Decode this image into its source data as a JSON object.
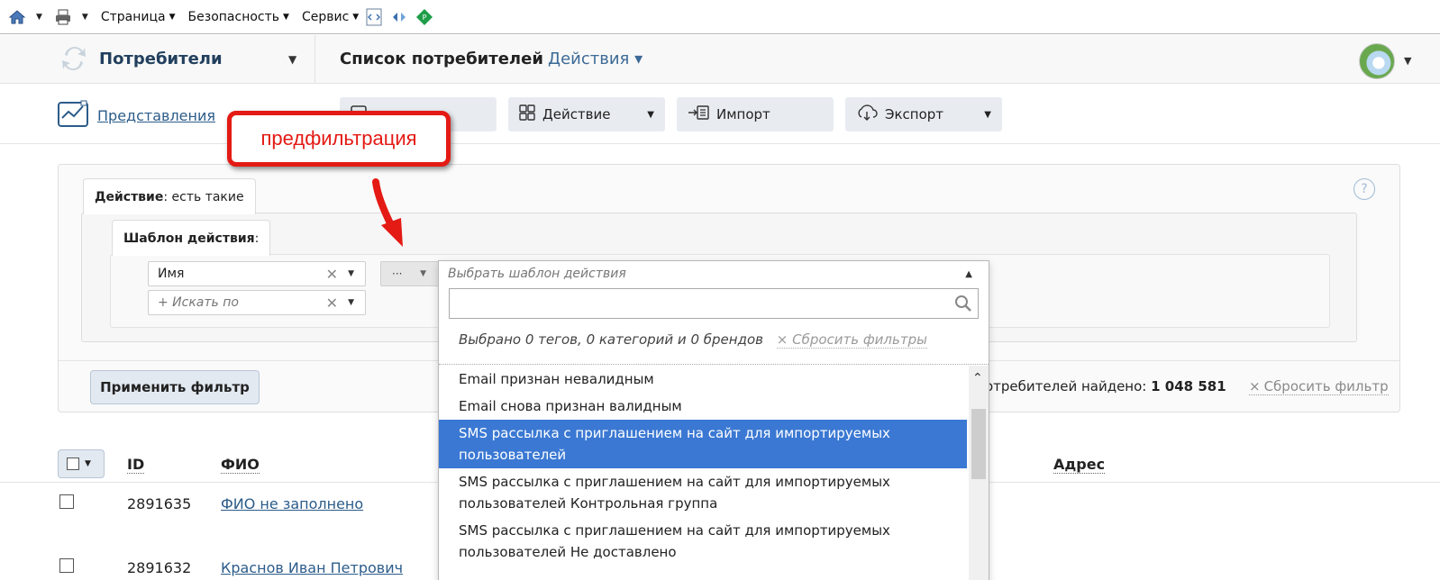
{
  "ie_toolbar": {
    "page_menu": "Страница",
    "safety_menu": "Безопасность",
    "service_menu": "Сервис"
  },
  "header": {
    "app_name": "Потребители",
    "page_title": "Список потребителей",
    "actions_menu": "Действия ▾"
  },
  "toolbar": {
    "views_label": "Представления",
    "action_label": "Действие",
    "import_label": "Импорт",
    "export_label": "Экспорт"
  },
  "annotation": {
    "text": "предфильтрация"
  },
  "filter": {
    "tab1_bold": "Действие",
    "tab1_rest": ": есть такие",
    "tab2_bold": "Шаблон действия",
    "tab2_rest": ":",
    "field1_value": "Имя",
    "field2_placeholder": "+ Искать по",
    "ellipsis": "···",
    "apply_button": "Применить фильтр",
    "found_label": "отребителей найдено: ",
    "found_count": "1 048 581",
    "reset_filter": "Сбросить фильтр",
    "help": "?"
  },
  "dropdown": {
    "placeholder": "Выбрать шаблон действия",
    "search_value": "",
    "info": "Выбрано 0 тегов, 0 категорий и 0 брендов",
    "reset_filters": "Сбросить фильтры",
    "items": [
      {
        "label": "Email признан невалидным",
        "selected": false
      },
      {
        "label": "Email снова признан валидным",
        "selected": false
      },
      {
        "label": "SMS рассылка с приглашением на сайт для импортируемых пользователей",
        "selected": true
      },
      {
        "label": "SMS рассылка с приглашением на сайт для импортируемых пользователей Контрольная группа",
        "selected": false
      },
      {
        "label": "SMS рассылка с приглашением на сайт для импортируемых пользователей Не доставлено",
        "selected": false
      }
    ]
  },
  "table": {
    "headers": {
      "id": "ID",
      "name": "ФИО",
      "address": "Адрес"
    },
    "rows": [
      {
        "id": "2891635",
        "name": "ФИО не заполнено"
      },
      {
        "id": "2891632",
        "name": "Краснов Иван Петрович"
      }
    ]
  },
  "colors": {
    "accent": "#3a78d3",
    "link": "#2c5c8a",
    "annotation": "#e41a14"
  }
}
